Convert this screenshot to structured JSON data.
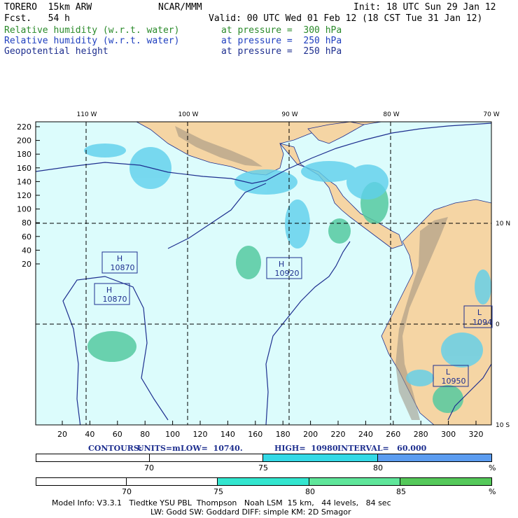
{
  "header": {
    "model": "TORERO  15km ARW",
    "org": "NCAR/MMM",
    "init": "Init: 18 UTC Sun 29 Jan 12",
    "fcst": "Fcst.   54 h",
    "valid": "Valid: 00 UTC Wed 01 Feb 12 (18 CST Tue 31 Jan 12)",
    "fields": [
      {
        "name": "Relative humidity (w.r.t. water)",
        "level": "at pressure =  300 hPa",
        "color": "#2a8a2a"
      },
      {
        "name": "Relative humidity (w.r.t. water)",
        "level": "at pressure =  250 hPa",
        "color": "#1f3fbf"
      },
      {
        "name": "Geopotential height",
        "level": "at pressure =  250 hPa",
        "color": "#1e2f8f"
      }
    ]
  },
  "map": {
    "lon_labels": [
      "110 W",
      "100 W",
      "90 W",
      "80 W",
      "70 W"
    ],
    "lat_labels": [
      "10 N",
      "0",
      "10 S"
    ],
    "y_ticks": [
      "220",
      "200",
      "180",
      "160",
      "140",
      "120",
      "100",
      "80",
      "60",
      "40",
      "20"
    ],
    "x_ticks": [
      "20",
      "40",
      "60",
      "80",
      "100",
      "120",
      "140",
      "160",
      "180",
      "200",
      "220",
      "240",
      "260",
      "280",
      "300",
      "320"
    ],
    "highs_lows": [
      {
        "type": "H",
        "value": "10870"
      },
      {
        "type": "H",
        "value": "10870"
      },
      {
        "type": "H",
        "value": "10920"
      },
      {
        "type": "L",
        "value": "1094"
      },
      {
        "type": "L",
        "value": "10950"
      }
    ],
    "colors": {
      "ocean": "#dcfcfc",
      "land": "#f5d5a4",
      "terrain": "#9a8f80",
      "contour": "#1e2f8f"
    }
  },
  "contour_info": {
    "label": "CONTOURS:",
    "units": "UNITS=m",
    "low": "LOW=  10740.",
    "high": "HIGH=  10980.",
    "interval": "INTERVAL=   60.000"
  },
  "colorbar_250": {
    "labels": [
      "70",
      "75",
      "80"
    ],
    "unit": "%",
    "colors": [
      "#ffffff",
      "#ffffff",
      "#33d9e6",
      "#5b9cf0"
    ]
  },
  "colorbar_300": {
    "labels": [
      "70",
      "75",
      "80",
      "85"
    ],
    "unit": "%",
    "colors": [
      "#ffffff",
      "#ffffff",
      "#33e6cf",
      "#5fe69a",
      "#55c95a"
    ]
  },
  "footer": {
    "line1": "Model Info: V3.3.1   Tiedtke YSU PBL  Thompson   Noah LSM  15 km,   44 levels,   84 sec",
    "line2": "LW: Godd SW: Goddard DIFF: simple KM: 2D Smagor"
  }
}
